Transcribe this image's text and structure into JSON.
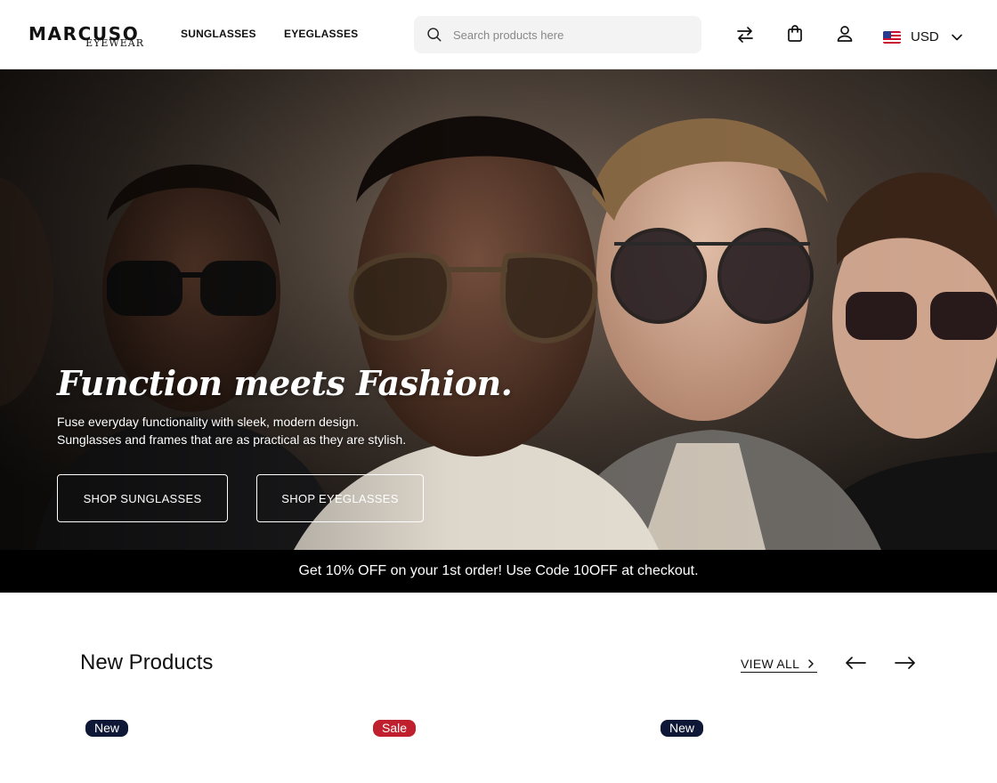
{
  "header": {
    "logo_main": "MARCUSO",
    "logo_sub": "EYEWEAR",
    "nav": [
      {
        "label": "SUNGLASSES"
      },
      {
        "label": "EYEGLASSES"
      }
    ],
    "search": {
      "placeholder": "Search products here"
    },
    "currency": {
      "label": "USD"
    }
  },
  "hero": {
    "title": "Function meets Fashion.",
    "line1": "Fuse everyday functionality with sleek, modern design.",
    "line2": "Sunglasses and frames that are as practical as they are stylish.",
    "buttons": [
      {
        "label": "SHOP SUNGLASSES"
      },
      {
        "label": "SHOP EYEGLASSES"
      }
    ]
  },
  "promo": {
    "text": "Get 10% OFF on your 1st order! Use Code 10OFF at checkout."
  },
  "new_products": {
    "title": "New Products",
    "view_all": "VIEW ALL",
    "badges": [
      {
        "label": "New",
        "color": "#0e1836"
      },
      {
        "label": "Sale",
        "color": "#c0202d"
      },
      {
        "label": "New",
        "color": "#0e1836"
      }
    ]
  },
  "icons": [
    "search-icon",
    "compare-arrows-icon",
    "shopping-bag-icon",
    "user-icon",
    "us-flag-icon",
    "chevron-down-icon",
    "chevron-right-icon",
    "arrow-left-icon",
    "arrow-right-icon"
  ]
}
